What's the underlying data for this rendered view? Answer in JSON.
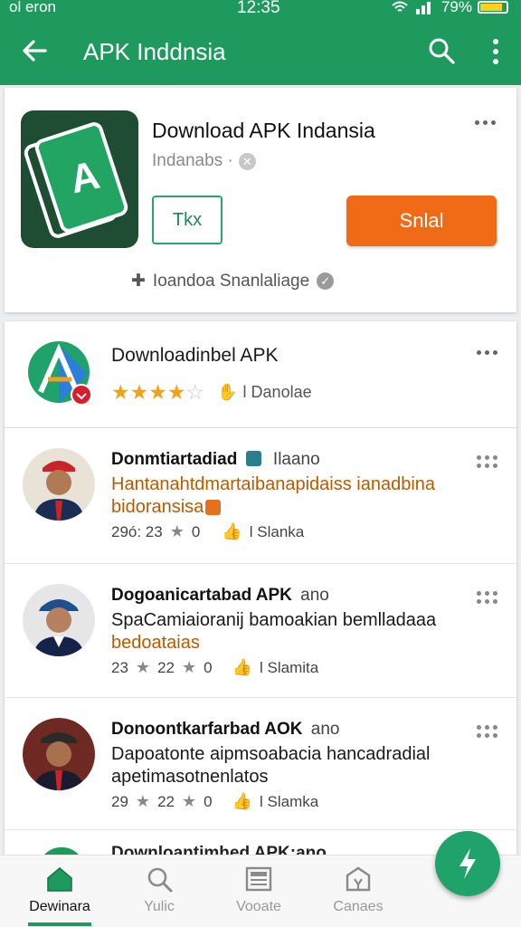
{
  "status": {
    "carrier": "ol eron",
    "time": "12:35",
    "battery": "79%"
  },
  "toolbar": {
    "title": "APK Inddnsia"
  },
  "hero": {
    "title": "Download APK Indansia",
    "subtitle": "Indanabs ·",
    "outline_button": "Tkx",
    "primary_button": "Snlal",
    "footer": "Ioandoa Snanlaliage"
  },
  "featured": {
    "title": "Downloadinbel APK",
    "rating": 4,
    "rating_max": 5,
    "meta": "l Danolae"
  },
  "reviews": [
    {
      "name": "Donmtiartadiad",
      "alt": "Ilaano",
      "body1": "Hantanahtdmartaibanapidaiss ianadbina",
      "body2": "bidoransisa",
      "count1": "29ó: 23",
      "count2": "0",
      "likes": "l Slanka"
    },
    {
      "name": "Dogoanicartabad APK",
      "alt": "ano",
      "body1": "SpaCamiaioranij bamoakian bemlladaaa",
      "body2": "bedoataias",
      "count1": "23",
      "count2": "22",
      "count3": "0",
      "likes": "l Slamita"
    },
    {
      "name": "Donoontkarfarbad AOK",
      "alt": "ano",
      "body1": "Dapoatonte aipmsoabacia hancadradial",
      "body2": "apetimasotnenlatos",
      "count1": "29",
      "count2": "22",
      "count3": "0",
      "likes": "l Slamka"
    }
  ],
  "partial_row": {
    "title": "Downloantimhed APK:ano"
  },
  "bottom_nav": [
    {
      "label": "Dewinara",
      "icon": "home-icon",
      "active": true
    },
    {
      "label": "Yulic",
      "icon": "search-icon",
      "active": false
    },
    {
      "label": "Vooate",
      "icon": "news-icon",
      "active": false
    },
    {
      "label": "Canaes",
      "icon": "apps-icon",
      "active": false
    }
  ],
  "colors": {
    "brand": "#1f9a5e",
    "accent": "#f16a16",
    "star": "#f0a21c"
  }
}
